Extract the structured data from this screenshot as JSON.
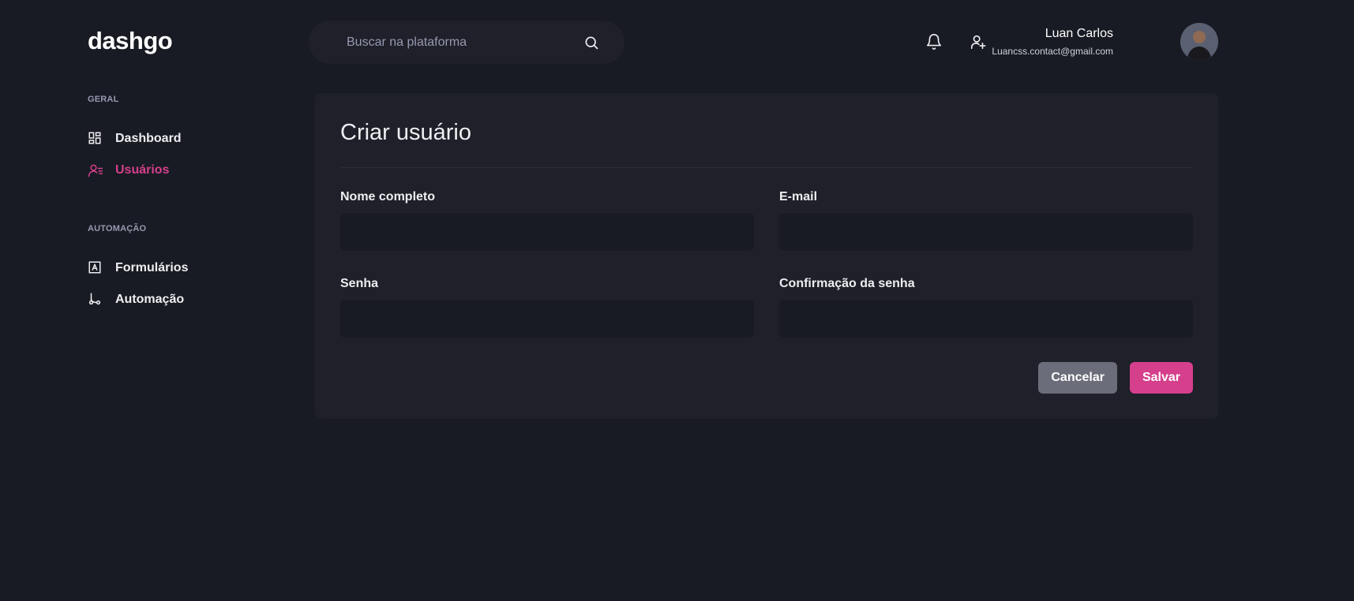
{
  "app": {
    "logo": "dashgo"
  },
  "search": {
    "placeholder": "Buscar na plataforma",
    "icon": "search-icon"
  },
  "header": {
    "icons": [
      "bell-icon",
      "user-plus-icon"
    ]
  },
  "profile": {
    "name": "Luan Carlos",
    "email": "Luancss.contact@gmail.com"
  },
  "sidebar": {
    "sections": [
      {
        "title": "GERAL",
        "items": [
          {
            "label": "Dashboard",
            "icon": "dashboard-icon",
            "active": false
          },
          {
            "label": "Usuários",
            "icon": "users-icon",
            "active": true
          }
        ]
      },
      {
        "title": "AUTOMAÇÃO",
        "items": [
          {
            "label": "Formulários",
            "icon": "form-icon",
            "active": false
          },
          {
            "label": "Automação",
            "icon": "git-branch-icon",
            "active": false
          }
        ]
      }
    ]
  },
  "form": {
    "title": "Criar usuário",
    "fields": {
      "name": {
        "label": "Nome completo",
        "value": ""
      },
      "email": {
        "label": "E-mail",
        "value": ""
      },
      "password": {
        "label": "Senha",
        "value": ""
      },
      "password_confirmation": {
        "label": "Confirmação da senha",
        "value": ""
      }
    },
    "cancel_label": "Cancelar",
    "save_label": "Salvar"
  },
  "colors": {
    "background": "#181B23",
    "card": "#1F2029",
    "accent": "#D53F8C",
    "muted": "#9699B0",
    "cancel": "#6B6D7A"
  }
}
